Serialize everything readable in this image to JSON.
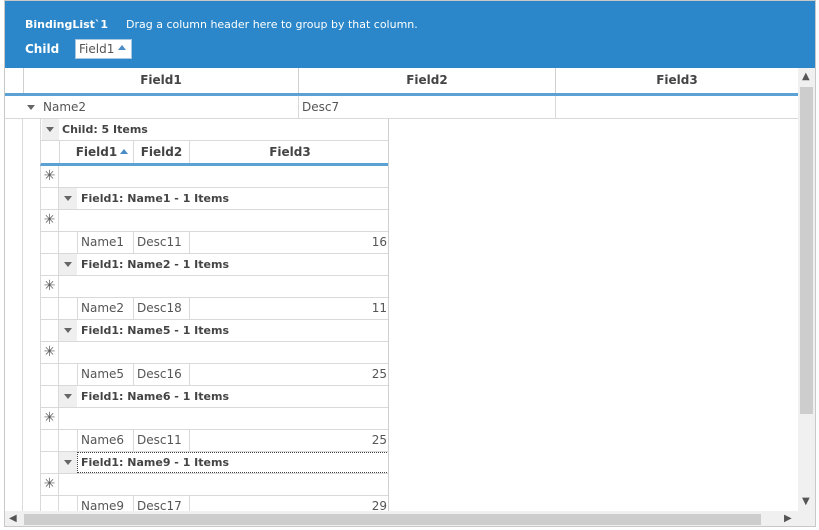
{
  "group_panel": {
    "title": "BindingList`1",
    "hint": "Drag a column header here to group by that column.",
    "child_label": "Child",
    "chip_label": "Field1"
  },
  "master": {
    "columns": [
      "Field1",
      "Field2",
      "Field3"
    ],
    "row": {
      "field1": "Name2",
      "field2": "Desc7",
      "field3": ""
    }
  },
  "child": {
    "caption": "Child: 5 Items",
    "columns": [
      "Field1",
      "Field2",
      "Field3"
    ],
    "groups": [
      {
        "header": "Field1: Name1 - 1 Items",
        "field1": "Name1",
        "field2": "Desc11",
        "field3": "16"
      },
      {
        "header": "Field1: Name2 - 1 Items",
        "field1": "Name2",
        "field2": "Desc18",
        "field3": "11"
      },
      {
        "header": "Field1: Name5 - 1 Items",
        "field1": "Name5",
        "field2": "Desc16",
        "field3": "25"
      },
      {
        "header": "Field1: Name6 - 1 Items",
        "field1": "Name6",
        "field2": "Desc11",
        "field3": "25"
      },
      {
        "header": "Field1: Name9 - 1 Items",
        "field1": "Name9",
        "field2": "Desc17",
        "field3": "29"
      }
    ],
    "new_row_glyph": "✳"
  }
}
